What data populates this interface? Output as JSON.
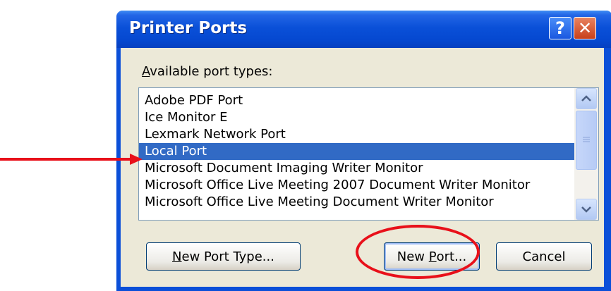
{
  "window": {
    "title": "Printer Ports",
    "help_glyph": "?",
    "close_glyph": "✕"
  },
  "port_types": {
    "label_accesskey": "A",
    "label_rest": "vailable port types:",
    "items": [
      {
        "label": "Adobe PDF Port"
      },
      {
        "label": "Ice Monitor E"
      },
      {
        "label": "Lexmark Network Port"
      },
      {
        "label": "Local Port",
        "selected": true
      },
      {
        "label": "Microsoft Document Imaging Writer Monitor"
      },
      {
        "label": "Microsoft Office Live Meeting 2007 Document Writer Monitor"
      },
      {
        "label": "Microsoft Office Live Meeting Document Writer Monitor"
      }
    ],
    "selected_index": 3
  },
  "buttons": {
    "new_port_type": {
      "accesskey": "N",
      "rest": "ew Port Type..."
    },
    "new_port": {
      "before": "New ",
      "accesskey": "P",
      "after": "ort..."
    },
    "cancel": "Cancel"
  },
  "annotations": {
    "arrow_color": "#e8101a",
    "circle_color": "#e8101a",
    "arrow_target": "Local Port",
    "circle_target": "New Port..."
  },
  "icons": {
    "scroll_up": "scroll-up-arrow-icon",
    "scroll_down": "scroll-down-arrow-icon",
    "scroll_thumb": "scroll-thumb-grip-icon"
  },
  "colors": {
    "title_bar": "#0548d0",
    "client_bg": "#ece9d8",
    "selection": "#316ac5",
    "close_button": "#c8401a"
  }
}
